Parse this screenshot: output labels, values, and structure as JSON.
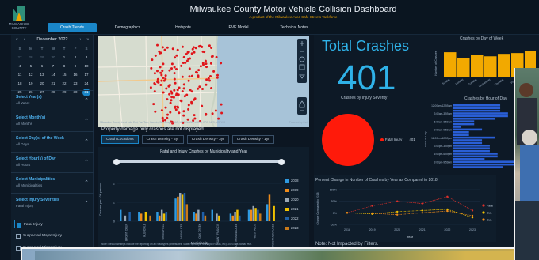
{
  "header": {
    "logo_text": "MILWAUKEE COUNTY",
    "title": "Milwaukee County Motor Vehicle Collision Dashboard",
    "subtitle": "A product of the Milwaukee Area Safe Streets Taskforce",
    "nav": [
      "Crash Trends",
      "Demographics",
      "Hotspots",
      "EVE Model",
      "Technical Notes"
    ],
    "nav_active": 0
  },
  "calendar": {
    "month_label": "December 2022",
    "prev": "«",
    "prev2": "‹",
    "next": "›",
    "next2": "»",
    "weekdays": [
      "S",
      "M",
      "T",
      "W",
      "T",
      "F",
      "S"
    ],
    "weeks": [
      [
        "27",
        "28",
        "29",
        "30",
        "1",
        "2",
        "3"
      ],
      [
        "4",
        "5",
        "6",
        "7",
        "8",
        "9",
        "10"
      ],
      [
        "11",
        "12",
        "13",
        "14",
        "15",
        "16",
        "17"
      ],
      [
        "18",
        "19",
        "20",
        "21",
        "22",
        "23",
        "24"
      ],
      [
        "25",
        "26",
        "27",
        "28",
        "29",
        "30",
        "31"
      ]
    ],
    "selected": "31"
  },
  "filters": [
    {
      "title": "Select Year(s)",
      "value": "All Years"
    },
    {
      "title": "Select Month(s)",
      "value": "All Months"
    },
    {
      "title": "Select Day(s) of the Week",
      "value": "All Days"
    },
    {
      "title": "Select Hour(s) of Day",
      "value": "All Hours"
    },
    {
      "title": "Select Municipalities",
      "value": "All Municipalities"
    },
    {
      "title": "Select Injury Severities",
      "value": "Fatal Injury"
    }
  ],
  "severity_options": [
    {
      "label": "Fatal Injury",
      "checked": true
    },
    {
      "label": "Suspected Major Injury",
      "checked": false
    },
    {
      "label": "Suspected Minor Injury",
      "checked": false
    }
  ],
  "map": {
    "credit": "Milwaukee County Land Info, Esri, TomTom, Garmin, SafeGraph, FAO, METI/NASA, USGS, EPA, NPS, USFWS",
    "powered": "Powered by Esri",
    "note": "Property damage only crashes are not displayed",
    "tabs": [
      "Crash Locations",
      "Crash Density - 5yr",
      "Crash Density - 3yr",
      "Crash Density - 1yr"
    ],
    "active_tab": 0
  },
  "muni_chart": {
    "title": "Fatal and Injury Crashes by Municipality and Year",
    "xlabel": "Municipality",
    "ylabel": "Crashes per 10k persons",
    "note": "Note: Default settings include the reporting on all road types (Interstates, State Highways, Municipal Roads, etc). 2023 is a partial year."
  },
  "total": {
    "title": "Total Crashes",
    "value": "401"
  },
  "severity_chart": {
    "title": "Crashes by Injury Severity",
    "legend_label": "Fatal Injury",
    "legend_value": "401",
    "color": "#ff1a0a"
  },
  "dow_chart": {
    "title": "Crashes by Day of Week",
    "ylabel": "Number of Crashes"
  },
  "hod_chart": {
    "title": "Crashes by Hour of Day",
    "ylabel": "Hour of Day"
  },
  "pct_chart": {
    "title": "Percent Change in Number of Crashes by Year as Compared to 2018",
    "xlabel": "Year",
    "ylabel": "Change Compared to 2018",
    "legend": [
      "Fatal",
      "Sus.",
      "Sus."
    ]
  },
  "pct_note": "Note: Not Impacted by Filters.",
  "chart_data": [
    {
      "type": "bar",
      "title": "Fatal and Injury Crashes by Municipality and Year",
      "xlabel": "Municipality",
      "ylabel": "Crashes per 10k persons",
      "ylim": [
        0,
        2.5
      ],
      "categories": [
        "BROWN DEER",
        "GLENDALE",
        "GREENFIELD",
        "MILWAUKEE",
        "OAK CREEK",
        "SAINT FRANCIS",
        "SOUTH MILWAUKEE",
        "WEST ALLIS",
        "WEST MILWAUKEE"
      ],
      "series": [
        {
          "name": "2018",
          "color": "#2f9ae0",
          "values": [
            0.6,
            0.5,
            0.5,
            1.2,
            0.5,
            0.6,
            0.4,
            0.6,
            0.9
          ]
        },
        {
          "name": "2019",
          "color": "#f08c1a",
          "values": [
            0.0,
            0.4,
            0.3,
            1.3,
            0.4,
            0.0,
            0.3,
            0.6,
            1.4
          ]
        },
        {
          "name": "2020",
          "color": "#9aa8b6",
          "values": [
            0.3,
            0.0,
            0.6,
            1.5,
            0.6,
            0.4,
            0.5,
            0.8,
            0.0
          ]
        },
        {
          "name": "2021",
          "color": "#f2c200",
          "values": [
            0.0,
            0.5,
            0.4,
            1.4,
            0.0,
            0.3,
            0.6,
            0.7,
            0.8
          ]
        },
        {
          "name": "2022",
          "color": "#1f5fa8",
          "values": [
            0.5,
            0.0,
            0.5,
            1.5,
            0.5,
            0.0,
            0.3,
            0.6,
            0.0
          ]
        },
        {
          "name": "2023",
          "color": "#c97a1a",
          "values": [
            0.0,
            0.3,
            0.0,
            0.9,
            0.3,
            0.0,
            0.0,
            0.4,
            0.0
          ]
        }
      ],
      "ticks": [
        "0",
        "1",
        "2"
      ],
      "legend_placement": "right"
    },
    {
      "type": "bar",
      "title": "Crashes by Day of Week",
      "ylabel": "Number of Crashes",
      "categories": [
        "Sunday",
        "Monday",
        "Tuesday",
        "Wednesday",
        "Thursday",
        "Friday",
        "Saturday"
      ],
      "values": [
        62,
        48,
        55,
        52,
        58,
        60,
        66
      ],
      "ylim": [
        0,
        70
      ],
      "color": "#f2a900"
    },
    {
      "type": "bar",
      "title": "Crashes by Hour of Day",
      "ylabel": "Hour of Day",
      "categories": [
        "12:00am-12:59am",
        "3:00am-3:59am",
        "6:00am-6:59am",
        "9:00am-9:59am",
        "12:00pm-12:59pm",
        "3:00pm-3:59pm",
        "6:00pm-6:59pm",
        "9:00pm-9:59pm"
      ],
      "values": [
        20,
        22,
        8,
        10,
        14,
        16,
        18,
        24
      ],
      "color": "#2a5fd6"
    },
    {
      "type": "line",
      "title": "Percent Change in Number of Crashes by Year as Compared to 2018",
      "xlabel": "Year",
      "ylabel": "Change Compared to 2018",
      "x": [
        "2018",
        "2019",
        "2020",
        "2021",
        "2022",
        "2023"
      ],
      "ylim": [
        -50,
        100
      ],
      "ticks": [
        "100%",
        "50%",
        "0%",
        "-50%"
      ],
      "series": [
        {
          "color": "#e0302a",
          "values": [
            0,
            30,
            50,
            40,
            70,
            10
          ]
        },
        {
          "color": "#f2c200",
          "values": [
            0,
            -5,
            5,
            10,
            15,
            -20
          ]
        },
        {
          "color": "#f08c1a",
          "values": [
            0,
            -2,
            -8,
            0,
            8,
            -12
          ]
        }
      ]
    }
  ]
}
